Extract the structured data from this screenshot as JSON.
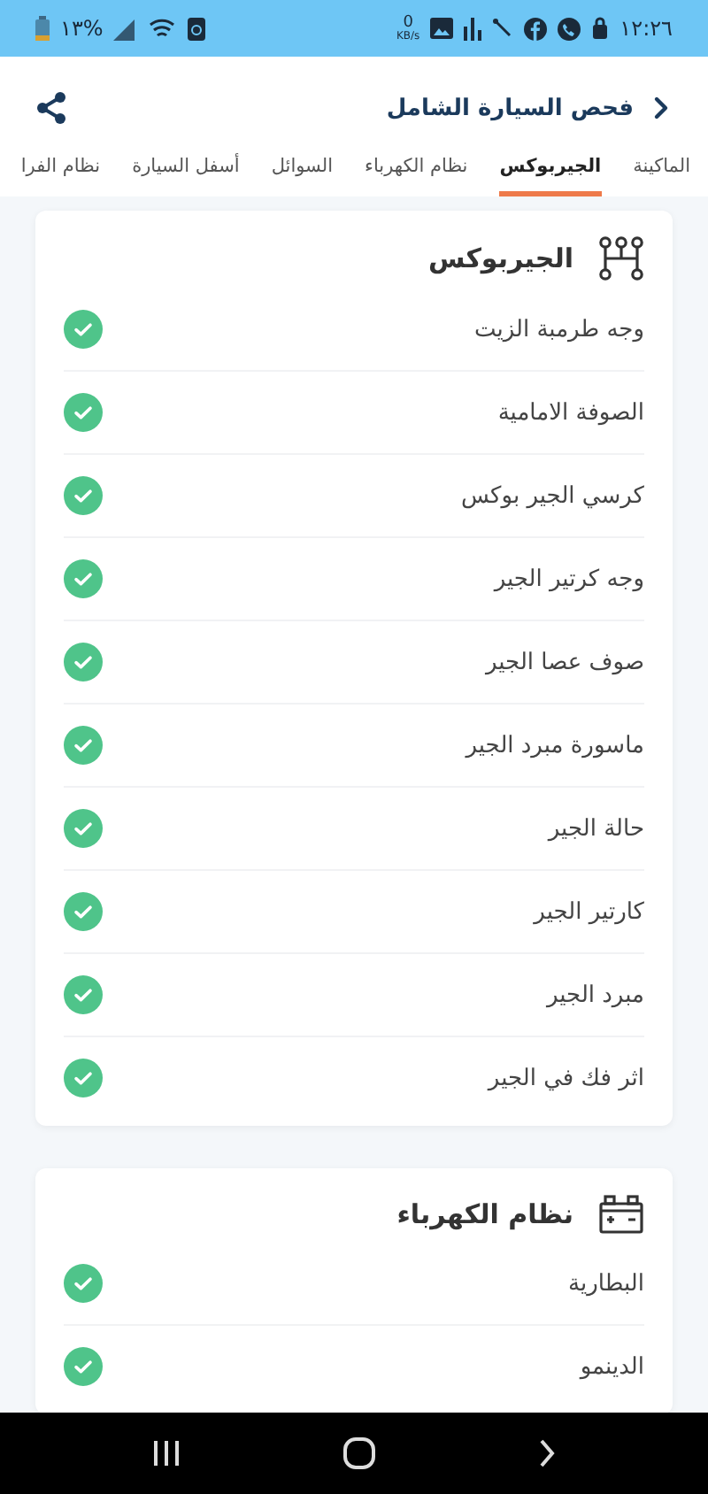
{
  "status_bar": {
    "time": "١٢:٢٦",
    "speed": "0",
    "speed_unit": "KB/s",
    "battery": "%١٣"
  },
  "header": {
    "title": "فحص السيارة الشامل"
  },
  "tabs": [
    {
      "label": "الماكينة",
      "selected": false
    },
    {
      "label": "الجيربوكس",
      "selected": true
    },
    {
      "label": "نظام الكهرباء",
      "selected": false
    },
    {
      "label": "السوائل",
      "selected": false
    },
    {
      "label": "أسفل السيارة",
      "selected": false
    },
    {
      "label": "نظام الفرا",
      "selected": false
    }
  ],
  "sections": [
    {
      "title": "الجيربوكس",
      "kind": "gearbox",
      "items": [
        {
          "label": "وجه طرمبة الزيت",
          "checked": true
        },
        {
          "label": "الصوفة الامامية",
          "checked": true
        },
        {
          "label": "كرسي الجير بوكس",
          "checked": true
        },
        {
          "label": "وجه كرتير الجير",
          "checked": true
        },
        {
          "label": "صوف عصا الجير",
          "checked": true
        },
        {
          "label": "ماسورة مبرد الجير",
          "checked": true
        },
        {
          "label": "حالة الجير",
          "checked": true
        },
        {
          "label": "كارتير الجير",
          "checked": true
        },
        {
          "label": "مبرد الجير",
          "checked": true
        },
        {
          "label": "اثر فك في الجير",
          "checked": true
        }
      ]
    },
    {
      "title": "نظام الكهرباء",
      "kind": "battery",
      "items": [
        {
          "label": "البطارية",
          "checked": true
        },
        {
          "label": "الدينمو",
          "checked": true
        }
      ]
    }
  ]
}
